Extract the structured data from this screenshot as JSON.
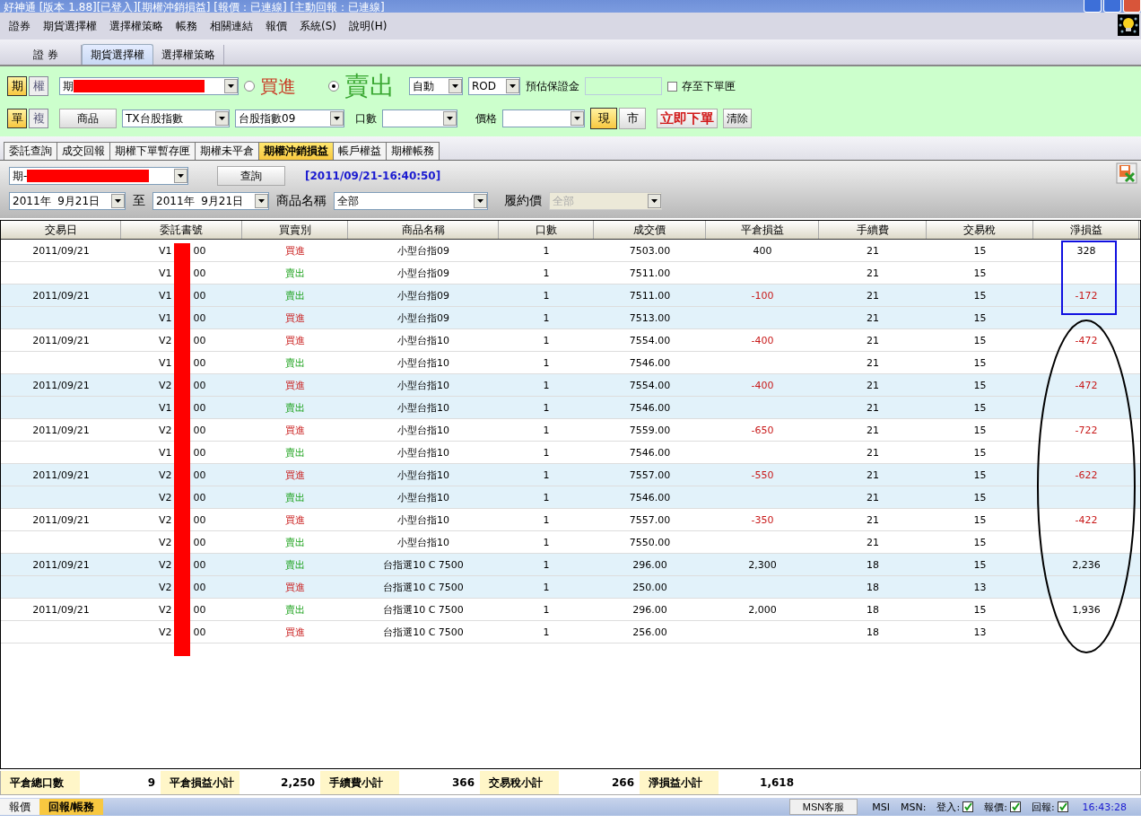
{
  "window": {
    "title": "好神通 [版本 1.88][已登入][期權沖銷損益] [報價：已連線] [主動回報：已連線]"
  },
  "menu": [
    "證券",
    "期貨選擇權",
    "選擇權策略",
    "帳務",
    "相關連結",
    "報價",
    "系統(S)",
    "說明(H)"
  ],
  "main_tabs": [
    {
      "label": "證 券",
      "selected": false
    },
    {
      "label": "期貨選擇權",
      "selected": true
    },
    {
      "label": "選擇權策略",
      "selected": false
    }
  ],
  "order_panel": {
    "mode_toggles": [
      {
        "label": "期",
        "selected": true
      },
      {
        "label": "權",
        "selected": false
      }
    ],
    "account": "期",
    "sides": [
      {
        "label": "買進",
        "kind": "buy",
        "selected": false
      },
      {
        "label": "賣出",
        "kind": "sell",
        "selected": true
      }
    ],
    "condition": "自動",
    "time_in_force": "ROD",
    "margin_label": "預估保證金",
    "save_checkbox": {
      "label": "存至下單匣",
      "checked": false
    },
    "order_toggles": [
      {
        "label": "單",
        "selected": true
      },
      {
        "label": "複",
        "selected": false
      }
    ],
    "product_button": "商品",
    "product": "TX台股指數",
    "contract": "台股指數09",
    "qty_label": "口數",
    "price_label": "價格",
    "price_types": [
      {
        "label": "現",
        "selected": true
      },
      {
        "label": "市",
        "selected": false
      }
    ],
    "submit": "立即下單",
    "clear": "清除"
  },
  "sub_tabs": [
    {
      "label": "委託查詢",
      "selected": false
    },
    {
      "label": "成交回報",
      "selected": false
    },
    {
      "label": "期權下單暫存匣",
      "selected": false
    },
    {
      "label": "期權未平倉",
      "selected": false
    },
    {
      "label": "期權沖銷損益",
      "selected": true
    },
    {
      "label": "帳戶權益",
      "selected": false
    },
    {
      "label": "期權帳務",
      "selected": false
    }
  ],
  "filter": {
    "account": "期-",
    "query_button": "查詢",
    "timestamp": "[2011/09/21-16:40:50]",
    "date_from": "2011年  9月21日",
    "to_label": "至",
    "date_to": "2011年  9月21日",
    "product_label": "商品名稱",
    "product": "全部",
    "strike_label": "履約價",
    "strike": {
      "value": "全部",
      "disabled": true
    }
  },
  "table": {
    "columns": [
      "交易日",
      "委託書號",
      "買賣別",
      "商品名稱",
      "口數",
      "成交價",
      "平倉損益",
      "手續費",
      "交易稅",
      "淨損益"
    ],
    "rows": [
      {
        "date": "2011/09/21",
        "order_prefix": "V1",
        "order_suffix": "00",
        "side": "買進",
        "kind": "buy",
        "product": "小型台指09",
        "qty": "1",
        "price": "7503.00",
        "close_pnl": "400",
        "fee": "21",
        "tax": "15",
        "net_pnl": "328",
        "negative": false
      },
      {
        "order_prefix": "V1",
        "order_suffix": "00",
        "side": "賣出",
        "kind": "sell",
        "product": "小型台指09",
        "qty": "1",
        "price": "7511.00",
        "fee": "21",
        "tax": "15"
      },
      {
        "date": "2011/09/21",
        "order_prefix": "V1",
        "order_suffix": "00",
        "side": "賣出",
        "kind": "sell",
        "product": "小型台指09",
        "qty": "1",
        "price": "7511.00",
        "close_pnl": "-100",
        "fee": "21",
        "tax": "15",
        "net_pnl": "-172",
        "negative": true
      },
      {
        "order_prefix": "V1",
        "order_suffix": "00",
        "side": "買進",
        "kind": "buy",
        "product": "小型台指09",
        "qty": "1",
        "price": "7513.00",
        "fee": "21",
        "tax": "15"
      },
      {
        "date": "2011/09/21",
        "order_prefix": "V2",
        "order_suffix": "00",
        "side": "買進",
        "kind": "buy",
        "product": "小型台指10",
        "qty": "1",
        "price": "7554.00",
        "close_pnl": "-400",
        "fee": "21",
        "tax": "15",
        "net_pnl": "-472",
        "negative": true
      },
      {
        "order_prefix": "V1",
        "order_suffix": "00",
        "side": "賣出",
        "kind": "sell",
        "product": "小型台指10",
        "qty": "1",
        "price": "7546.00",
        "fee": "21",
        "tax": "15"
      },
      {
        "date": "2011/09/21",
        "order_prefix": "V2",
        "order_suffix": "00",
        "side": "買進",
        "kind": "buy",
        "product": "小型台指10",
        "qty": "1",
        "price": "7554.00",
        "close_pnl": "-400",
        "fee": "21",
        "tax": "15",
        "net_pnl": "-472",
        "negative": true
      },
      {
        "order_prefix": "V1",
        "order_suffix": "00",
        "side": "賣出",
        "kind": "sell",
        "product": "小型台指10",
        "qty": "1",
        "price": "7546.00",
        "fee": "21",
        "tax": "15"
      },
      {
        "date": "2011/09/21",
        "order_prefix": "V2",
        "order_suffix": "00",
        "side": "買進",
        "kind": "buy",
        "product": "小型台指10",
        "qty": "1",
        "price": "7559.00",
        "close_pnl": "-650",
        "fee": "21",
        "tax": "15",
        "net_pnl": "-722",
        "negative": true
      },
      {
        "order_prefix": "V1",
        "order_suffix": "00",
        "side": "賣出",
        "kind": "sell",
        "product": "小型台指10",
        "qty": "1",
        "price": "7546.00",
        "fee": "21",
        "tax": "15"
      },
      {
        "date": "2011/09/21",
        "order_prefix": "V2",
        "order_suffix": "00",
        "side": "買進",
        "kind": "buy",
        "product": "小型台指10",
        "qty": "1",
        "price": "7557.00",
        "close_pnl": "-550",
        "fee": "21",
        "tax": "15",
        "net_pnl": "-622",
        "negative": true
      },
      {
        "order_prefix": "V2",
        "order_suffix": "00",
        "side": "賣出",
        "kind": "sell",
        "product": "小型台指10",
        "qty": "1",
        "price": "7546.00",
        "fee": "21",
        "tax": "15"
      },
      {
        "date": "2011/09/21",
        "order_prefix": "V2",
        "order_suffix": "00",
        "side": "買進",
        "kind": "buy",
        "product": "小型台指10",
        "qty": "1",
        "price": "7557.00",
        "close_pnl": "-350",
        "fee": "21",
        "tax": "15",
        "net_pnl": "-422",
        "negative": true
      },
      {
        "order_prefix": "V2",
        "order_suffix": "00",
        "side": "賣出",
        "kind": "sell",
        "product": "小型台指10",
        "qty": "1",
        "price": "7550.00",
        "fee": "21",
        "tax": "15"
      },
      {
        "date": "2011/09/21",
        "order_prefix": "V2",
        "order_suffix": "00",
        "side": "賣出",
        "kind": "sell",
        "product": "台指選10 C 7500",
        "qty": "1",
        "price": "296.00",
        "close_pnl": "2,300",
        "fee": "18",
        "tax": "15",
        "net_pnl": "2,236",
        "negative": false
      },
      {
        "order_prefix": "V2",
        "order_suffix": "00",
        "side": "買進",
        "kind": "buy",
        "product": "台指選10 C 7500",
        "qty": "1",
        "price": "250.00",
        "fee": "18",
        "tax": "13"
      },
      {
        "date": "2011/09/21",
        "order_prefix": "V2",
        "order_suffix": "00",
        "side": "賣出",
        "kind": "sell",
        "product": "台指選10 C 7500",
        "qty": "1",
        "price": "296.00",
        "close_pnl": "2,000",
        "fee": "18",
        "tax": "15",
        "net_pnl": "1,936",
        "negative": false
      },
      {
        "order_prefix": "V2",
        "order_suffix": "00",
        "side": "買進",
        "kind": "buy",
        "product": "台指選10 C 7500",
        "qty": "1",
        "price": "256.00",
        "fee": "18",
        "tax": "13"
      }
    ]
  },
  "summary": [
    {
      "label": "平倉總口數",
      "value": "9"
    },
    {
      "label": "平倉損益小計",
      "value": "2,250"
    },
    {
      "label": "手續費小計",
      "value": "366"
    },
    {
      "label": "交易稅小計",
      "value": "266"
    },
    {
      "label": "淨損益小計",
      "value": "1,618"
    }
  ],
  "bottom_tabs": [
    {
      "label": "報價",
      "selected": false
    },
    {
      "label": "回報/帳務",
      "selected": true
    }
  ],
  "status_bar": {
    "msn_button": "MSN客服",
    "msi": "MSI",
    "msn": "MSN:",
    "indicators": [
      {
        "label": "登入:",
        "checked": true
      },
      {
        "label": "報價:",
        "checked": true
      },
      {
        "label": "回報:",
        "checked": true
      }
    ],
    "time": "16:43:28"
  }
}
